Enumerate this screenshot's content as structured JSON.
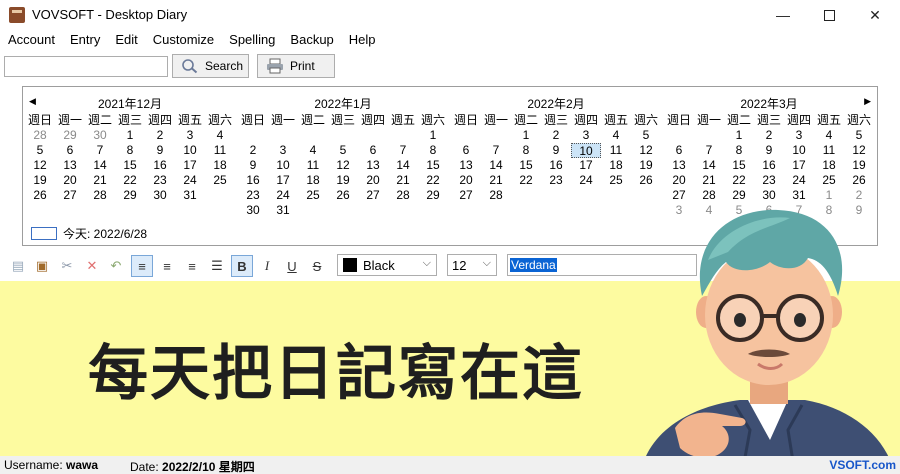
{
  "window": {
    "title": "VOVSOFT - Desktop Diary"
  },
  "menu": [
    "Account",
    "Entry",
    "Edit",
    "Customize",
    "Spelling",
    "Backup",
    "Help"
  ],
  "toolbar": {
    "search_label": "Search",
    "print_label": "Print",
    "search_value": ""
  },
  "calendar": {
    "weekday_headers": [
      "週日",
      "週一",
      "週二",
      "週三",
      "週四",
      "週五",
      "週六"
    ],
    "today_label": "今天: 2022/6/28",
    "months": [
      {
        "title": "2021年12月",
        "weeks": [
          [
            [
              "28",
              "g"
            ],
            [
              "29",
              "g"
            ],
            [
              "30",
              "g"
            ],
            [
              "1",
              ""
            ],
            [
              "2",
              ""
            ],
            [
              "3",
              ""
            ],
            [
              "4",
              ""
            ]
          ],
          [
            [
              "5",
              ""
            ],
            [
              "6",
              ""
            ],
            [
              "7",
              ""
            ],
            [
              "8",
              ""
            ],
            [
              "9",
              ""
            ],
            [
              "10",
              ""
            ],
            [
              "11",
              ""
            ]
          ],
          [
            [
              "12",
              ""
            ],
            [
              "13",
              ""
            ],
            [
              "14",
              ""
            ],
            [
              "15",
              ""
            ],
            [
              "16",
              ""
            ],
            [
              "17",
              ""
            ],
            [
              "18",
              ""
            ]
          ],
          [
            [
              "19",
              ""
            ],
            [
              "20",
              ""
            ],
            [
              "21",
              ""
            ],
            [
              "22",
              ""
            ],
            [
              "23",
              ""
            ],
            [
              "24",
              ""
            ],
            [
              "25",
              ""
            ]
          ],
          [
            [
              "26",
              ""
            ],
            [
              "27",
              ""
            ],
            [
              "28",
              ""
            ],
            [
              "29",
              ""
            ],
            [
              "30",
              ""
            ],
            [
              "31",
              ""
            ],
            [
              "",
              ""
            ]
          ]
        ]
      },
      {
        "title": "2022年1月",
        "weeks": [
          [
            [
              "",
              ""
            ],
            [
              "",
              ""
            ],
            [
              "",
              ""
            ],
            [
              "",
              ""
            ],
            [
              "",
              ""
            ],
            [
              "",
              ""
            ],
            [
              "1",
              ""
            ]
          ],
          [
            [
              "2",
              ""
            ],
            [
              "3",
              ""
            ],
            [
              "4",
              ""
            ],
            [
              "5",
              ""
            ],
            [
              "6",
              ""
            ],
            [
              "7",
              ""
            ],
            [
              "8",
              ""
            ]
          ],
          [
            [
              "9",
              ""
            ],
            [
              "10",
              ""
            ],
            [
              "11",
              ""
            ],
            [
              "12",
              ""
            ],
            [
              "13",
              ""
            ],
            [
              "14",
              ""
            ],
            [
              "15",
              ""
            ]
          ],
          [
            [
              "16",
              ""
            ],
            [
              "17",
              ""
            ],
            [
              "18",
              ""
            ],
            [
              "19",
              ""
            ],
            [
              "20",
              ""
            ],
            [
              "21",
              ""
            ],
            [
              "22",
              ""
            ]
          ],
          [
            [
              "23",
              ""
            ],
            [
              "24",
              ""
            ],
            [
              "25",
              ""
            ],
            [
              "26",
              ""
            ],
            [
              "27",
              ""
            ],
            [
              "28",
              ""
            ],
            [
              "29",
              ""
            ]
          ],
          [
            [
              "30",
              ""
            ],
            [
              "31",
              ""
            ],
            [
              "",
              ""
            ],
            [
              "",
              ""
            ],
            [
              "",
              ""
            ],
            [
              "",
              ""
            ],
            [
              "",
              ""
            ]
          ]
        ]
      },
      {
        "title": "2022年2月",
        "weeks": [
          [
            [
              "",
              ""
            ],
            [
              "",
              ""
            ],
            [
              "1",
              ""
            ],
            [
              "2",
              ""
            ],
            [
              "3",
              ""
            ],
            [
              "4",
              ""
            ],
            [
              "5",
              ""
            ]
          ],
          [
            [
              "6",
              ""
            ],
            [
              "7",
              ""
            ],
            [
              "8",
              ""
            ],
            [
              "9",
              ""
            ],
            [
              "10",
              "s"
            ],
            [
              "11",
              ""
            ],
            [
              "12",
              ""
            ]
          ],
          [
            [
              "13",
              ""
            ],
            [
              "14",
              ""
            ],
            [
              "15",
              ""
            ],
            [
              "16",
              ""
            ],
            [
              "17",
              ""
            ],
            [
              "18",
              ""
            ],
            [
              "19",
              ""
            ]
          ],
          [
            [
              "20",
              ""
            ],
            [
              "21",
              ""
            ],
            [
              "22",
              ""
            ],
            [
              "23",
              ""
            ],
            [
              "24",
              ""
            ],
            [
              "25",
              ""
            ],
            [
              "26",
              ""
            ]
          ],
          [
            [
              "27",
              ""
            ],
            [
              "28",
              ""
            ],
            [
              "",
              ""
            ],
            [
              "",
              ""
            ],
            [
              "",
              ""
            ],
            [
              "",
              ""
            ],
            [
              "",
              ""
            ]
          ]
        ]
      },
      {
        "title": "2022年3月",
        "weeks": [
          [
            [
              "",
              ""
            ],
            [
              "",
              ""
            ],
            [
              "1",
              ""
            ],
            [
              "2",
              ""
            ],
            [
              "3",
              ""
            ],
            [
              "4",
              ""
            ],
            [
              "5",
              ""
            ]
          ],
          [
            [
              "6",
              ""
            ],
            [
              "7",
              ""
            ],
            [
              "8",
              ""
            ],
            [
              "9",
              ""
            ],
            [
              "10",
              ""
            ],
            [
              "11",
              ""
            ],
            [
              "12",
              ""
            ]
          ],
          [
            [
              "13",
              ""
            ],
            [
              "14",
              ""
            ],
            [
              "15",
              ""
            ],
            [
              "16",
              ""
            ],
            [
              "17",
              ""
            ],
            [
              "18",
              ""
            ],
            [
              "19",
              ""
            ]
          ],
          [
            [
              "20",
              ""
            ],
            [
              "21",
              ""
            ],
            [
              "22",
              ""
            ],
            [
              "23",
              ""
            ],
            [
              "24",
              ""
            ],
            [
              "25",
              ""
            ],
            [
              "26",
              ""
            ]
          ],
          [
            [
              "27",
              ""
            ],
            [
              "28",
              ""
            ],
            [
              "29",
              ""
            ],
            [
              "30",
              ""
            ],
            [
              "31",
              ""
            ],
            [
              "1",
              "g"
            ],
            [
              "2",
              "g"
            ]
          ],
          [
            [
              "3",
              "g"
            ],
            [
              "4",
              "g"
            ],
            [
              "5",
              "g"
            ],
            [
              "6",
              "g"
            ],
            [
              "7",
              "g"
            ],
            [
              "8",
              "g"
            ],
            [
              "9",
              "g"
            ]
          ]
        ]
      }
    ]
  },
  "format": {
    "color_value": "Black",
    "size_value": "12",
    "font_value": "Verdana"
  },
  "editor": {
    "text": "每天把日記寫在這"
  },
  "status": {
    "username_label": "Username:",
    "username": "wawa",
    "date_label": "Date:",
    "date": "2022/2/10 星期四",
    "brand": "VSOFT.com"
  },
  "colors": {
    "editor_bg": "#fdfba0",
    "selection": "#0a64d4",
    "brand": "#1856c9"
  }
}
